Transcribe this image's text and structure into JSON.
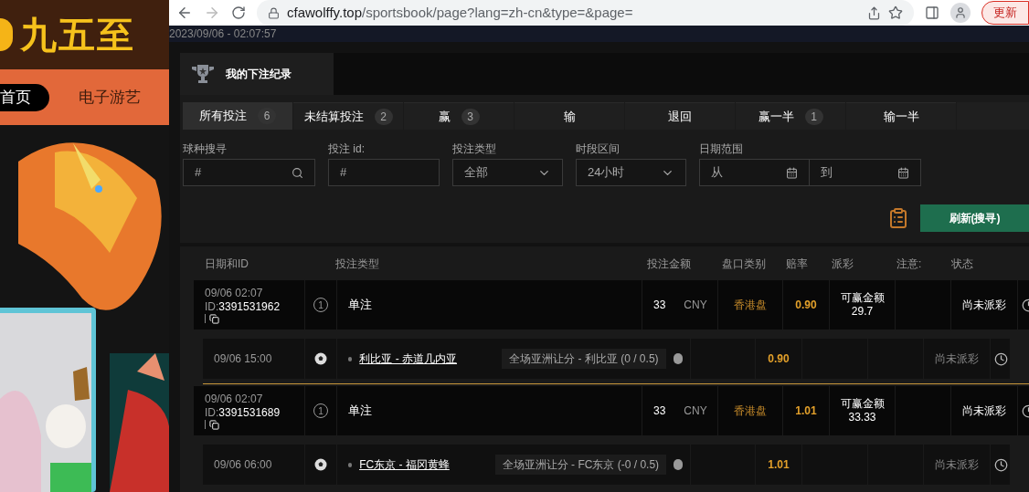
{
  "side_site": {
    "logo": "九五至",
    "nav": [
      {
        "label": "首页",
        "selected": true
      },
      {
        "label": "电子游艺",
        "selected": false
      }
    ]
  },
  "browser": {
    "url_host": "cfawolffy.top",
    "url_path": "/sportsbook/page?lang=zh-cn&type=&page=",
    "update_button": "更新"
  },
  "timestamp": "2023/09/06 - 02:07:57",
  "section_tab": "我的下注纪录",
  "tabs": [
    {
      "label": "所有投注",
      "count": "6",
      "selected": true
    },
    {
      "label": "未结算投注",
      "count": "2",
      "selected": false
    },
    {
      "label": "赢",
      "count": "3",
      "selected": false
    },
    {
      "label": "输",
      "selected": false
    },
    {
      "label": "退回",
      "selected": false
    },
    {
      "label": "赢一半",
      "count": "1",
      "selected": false
    },
    {
      "label": "输一半",
      "selected": false
    }
  ],
  "filters": [
    {
      "kind": "search",
      "label": "球种搜寻",
      "placeholder": "#"
    },
    {
      "kind": "text",
      "label": "投注 id:",
      "placeholder": "#"
    },
    {
      "kind": "select",
      "label": "投注类型",
      "value": "全部"
    },
    {
      "kind": "select",
      "label": "时段区间",
      "value": "24小时"
    },
    {
      "kind": "daterange",
      "label": "日期范围",
      "from_placeholder": "从",
      "to_placeholder": "到"
    }
  ],
  "refresh_button": "刷新(搜寻)",
  "table": {
    "columns": [
      "日期和ID",
      "投注类型",
      "投注金额",
      "盘口类别",
      "赔率",
      "派彩",
      "注意:",
      "状态"
    ],
    "rows": [
      {
        "kind": "bet",
        "date": "09/06 02:07",
        "id_prefix": "ID:",
        "id": "3391531962",
        "legs_count": "1",
        "type": "单注",
        "amount": "33",
        "currency": "CNY",
        "market": "香港盘",
        "odds": "0.90",
        "payout_label": "可赢金额",
        "payout": "29.7",
        "status": "尚未派彩"
      },
      {
        "kind": "leg",
        "time": "09/06 15:00",
        "match": "利比亚 - 赤道几内亚",
        "selection": "全场亚洲让分 - 利比亚 (0 / 0.5)",
        "odds": "0.90",
        "status": "尚未派彩"
      },
      {
        "kind": "bet",
        "date": "09/06 02:07",
        "id_prefix": "ID:",
        "id": "3391531689",
        "legs_count": "1",
        "type": "单注",
        "amount": "33",
        "currency": "CNY",
        "market": "香港盘",
        "odds": "1.01",
        "payout_label": "可赢金额",
        "payout": "33.33",
        "status": "尚未派彩"
      },
      {
        "kind": "leg",
        "time": "09/06 06:00",
        "match": "FC东京 - 福冈黄蜂",
        "selection": "全场亚洲让分 - FC东京 (-0 / 0.5)",
        "odds": "1.01",
        "status": "尚未派彩"
      }
    ]
  }
}
